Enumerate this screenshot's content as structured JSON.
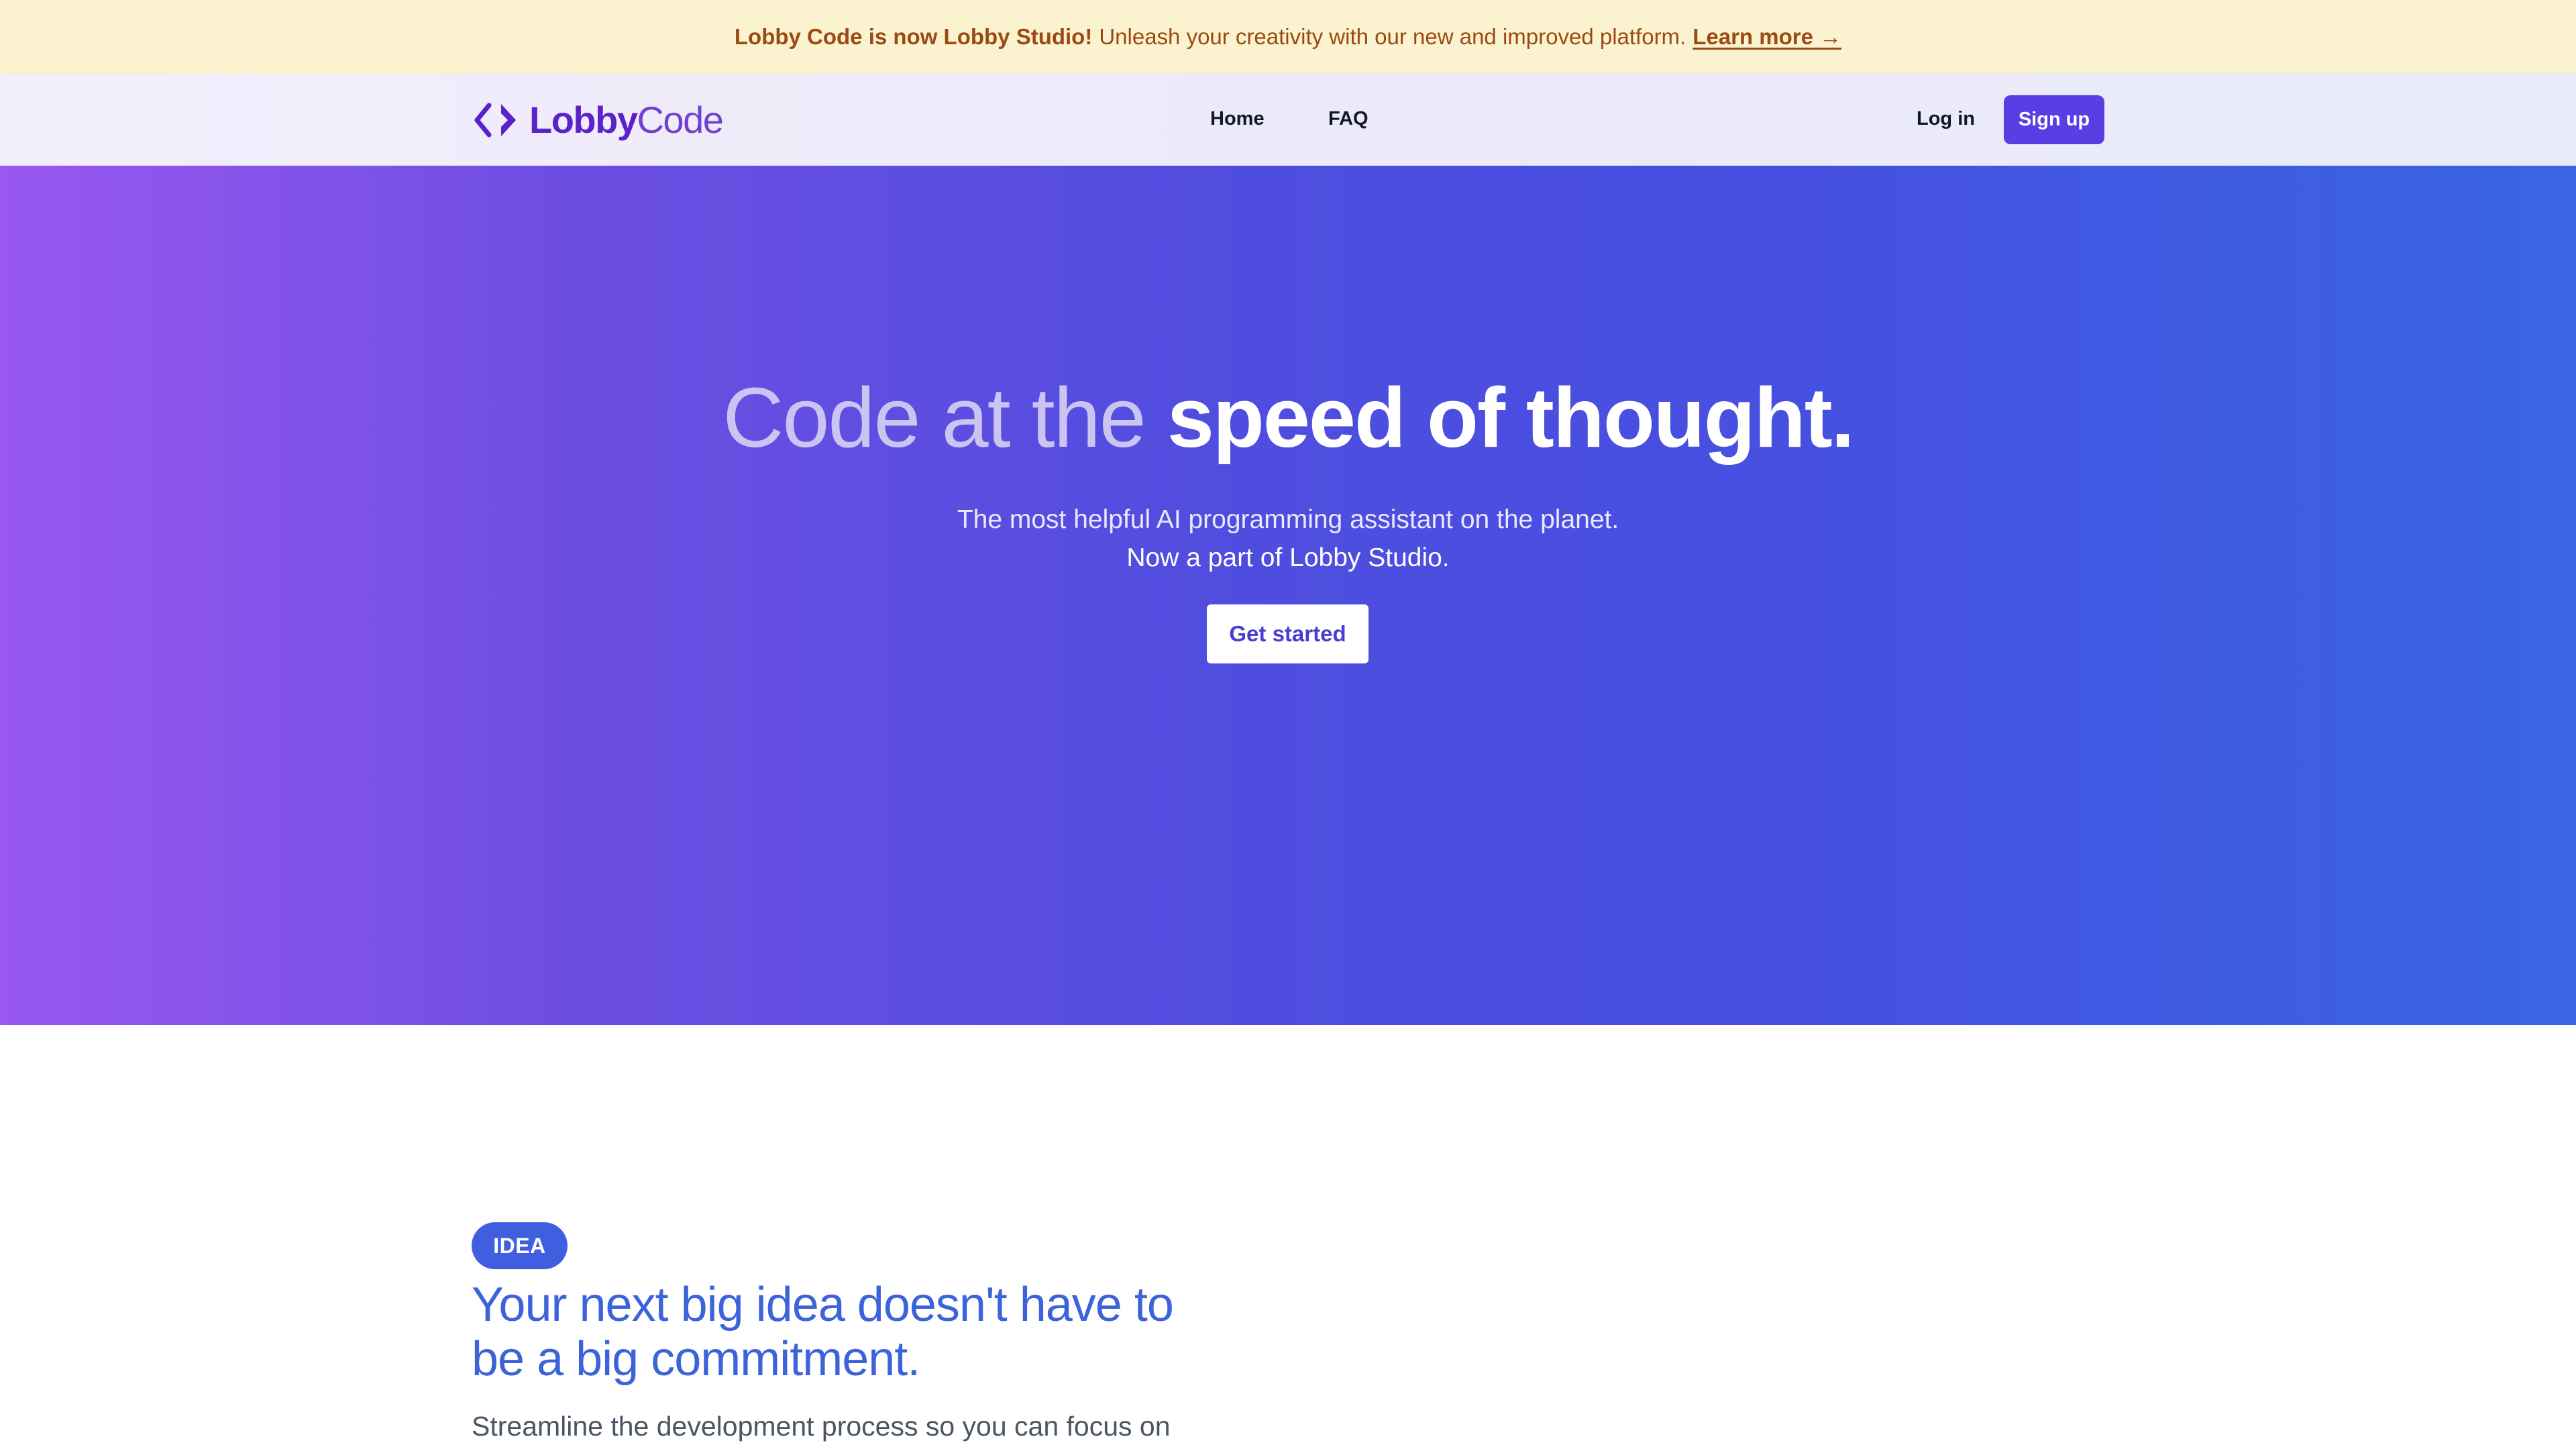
{
  "banner": {
    "bold_text": "Lobby Code is now Lobby Studio!",
    "message": "Unleash your creativity with our new and improved platform.",
    "link_text": "Learn more →"
  },
  "nav": {
    "logo_word1": "Lobby",
    "logo_word2": "Code",
    "home": "Home",
    "faq": "FAQ",
    "login": "Log in",
    "signup": "Sign up"
  },
  "hero": {
    "title_part1": "Code at the ",
    "title_part2": "speed of thought.",
    "subtitle_line1": "The most helpful AI programming assistant on the planet.",
    "subtitle_line2": "Now a part of Lobby Studio.",
    "cta": "Get started"
  },
  "section": {
    "badge": "IDEA",
    "title": "Your next big idea doesn't have to be a big commitment.",
    "body": "Streamline the development process so you can focus on"
  },
  "icons": {
    "logo": "code-brackets-icon"
  },
  "colors": {
    "banner_bg": "#fbf3cf",
    "banner_text": "#9a4a12",
    "brand_purple": "#5b22c9",
    "signup_bg": "#5a3ee4",
    "hero_gradient_start": "#9958f0",
    "hero_gradient_end": "#3965e4",
    "badge_bg": "#3f5fe0",
    "section_title": "#3c63d9"
  }
}
